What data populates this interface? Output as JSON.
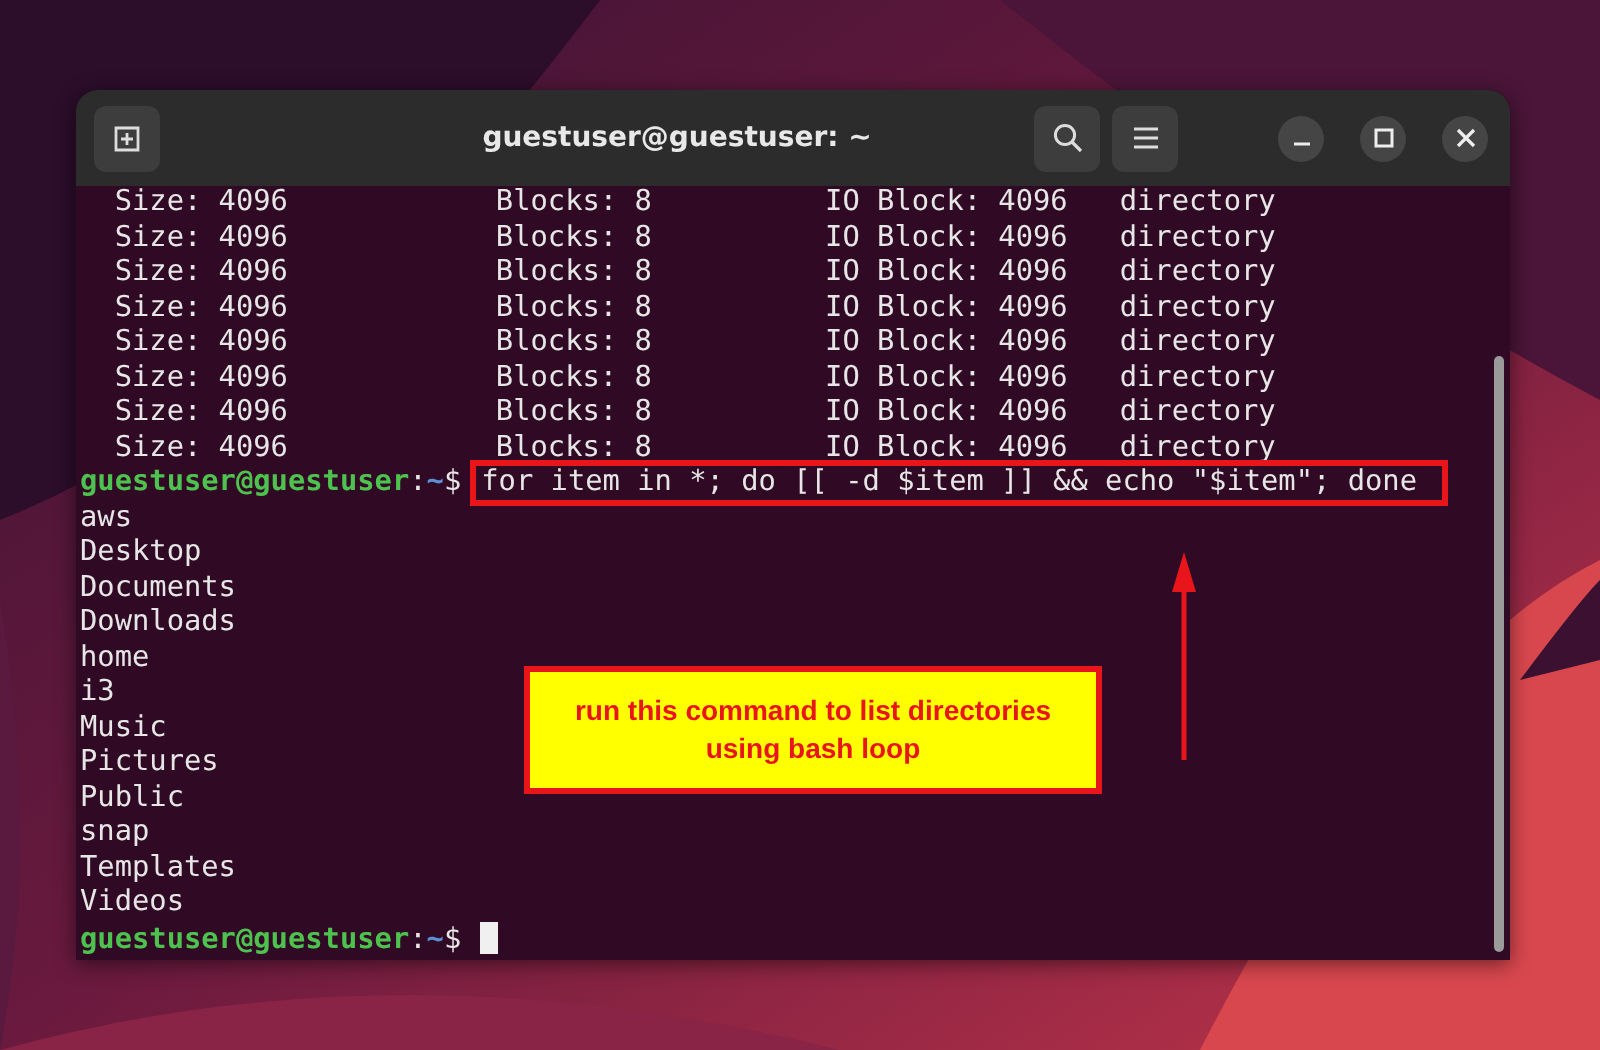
{
  "window": {
    "title": "guestuser@guestuser: ~"
  },
  "terminal": {
    "output_lines": [
      "  Size: 4096            Blocks: 8          IO Block: 4096   directory",
      "  Size: 4096            Blocks: 8          IO Block: 4096   directory",
      "  Size: 4096            Blocks: 8          IO Block: 4096   directory",
      "  Size: 4096            Blocks: 8          IO Block: 4096   directory",
      "  Size: 4096            Blocks: 8          IO Block: 4096   directory",
      "  Size: 4096            Blocks: 8          IO Block: 4096   directory",
      "  Size: 4096            Blocks: 8          IO Block: 4096   directory",
      "  Size: 4096            Blocks: 8          IO Block: 4096   directory"
    ],
    "command_line": {
      "prompt": {
        "user_host": "guestuser@guestuser",
        "separator": ":",
        "path": "~",
        "symbol": "$"
      },
      "command": "for item in *; do [[ -d $item ]] && echo \"$item\"; done"
    },
    "listing": [
      "aws",
      "Desktop",
      "Documents",
      "Downloads",
      "home",
      "i3",
      "Music",
      "Pictures",
      "Public",
      "snap",
      "Templates",
      "Videos"
    ],
    "current_prompt": {
      "user_host": "guestuser@guestuser",
      "separator": ":",
      "path": "~",
      "symbol": "$"
    }
  },
  "annotation": {
    "text": "run this command to list directories using bash loop"
  }
}
